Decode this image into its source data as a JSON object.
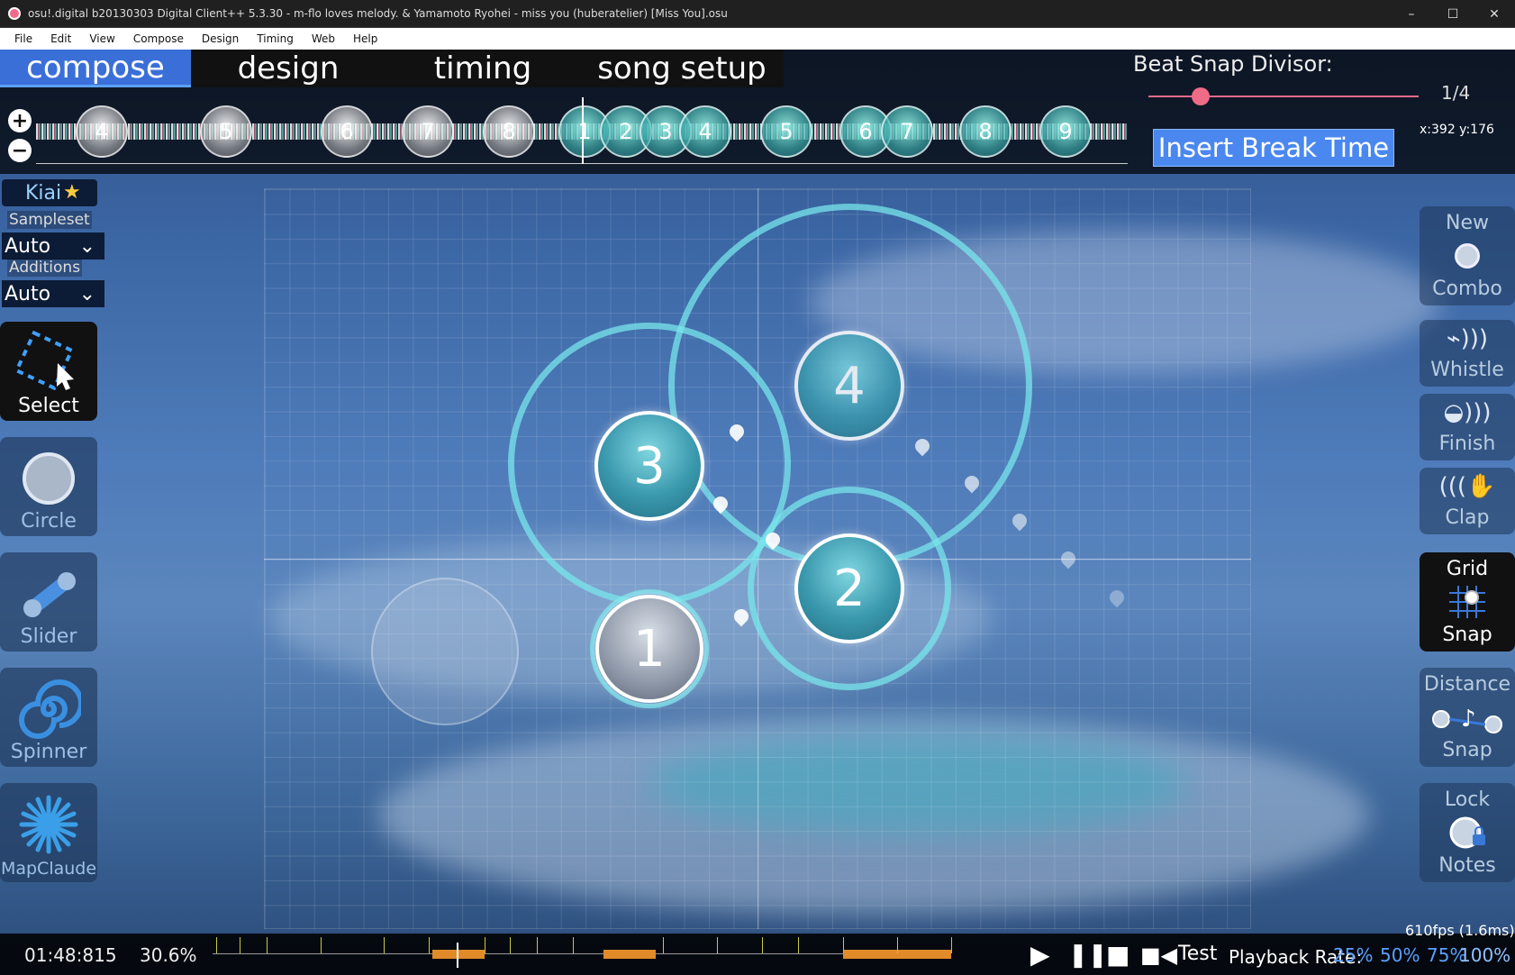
{
  "window": {
    "title": "osu!.digital b20130303 Digital Client++ 5.3.30 - m-flo loves melody. & Yamamoto Ryohei - miss you (huberatelier) [Miss You].osu",
    "minimize": "–",
    "maximize": "☐",
    "close": "✕"
  },
  "menu": [
    "File",
    "Edit",
    "View",
    "Compose",
    "Design",
    "Timing",
    "Web",
    "Help"
  ],
  "tabs": [
    {
      "label": "compose",
      "active": true
    },
    {
      "label": "design",
      "active": false
    },
    {
      "label": "timing",
      "active": false
    },
    {
      "label": "song setup",
      "active": false
    }
  ],
  "beat_snap": {
    "label": "Beat Snap Divisor:",
    "value": "1/4",
    "fraction": 0.18
  },
  "insert_break": "Insert Break Time",
  "cursor_coords": "x:392 y:176",
  "zoom": {
    "in": "+",
    "out": "−"
  },
  "timeline_notes": [
    "4",
    "5",
    "6",
    "7",
    "8",
    "1",
    "2",
    "3",
    "4",
    "5",
    "6",
    "7",
    "8",
    "9"
  ],
  "left_panel": {
    "kiai": "Kiai",
    "sampleset_label": "Sampleset",
    "sampleset_value": "Auto",
    "additions_label": "Additions",
    "additions_value": "Auto",
    "tools": [
      "Select",
      "Circle",
      "Slider",
      "Spinner",
      "MapClaude"
    ]
  },
  "right_panel": [
    {
      "top": "New",
      "bottom": "Combo",
      "icon": "new-combo-icon",
      "active": false
    },
    {
      "top": "",
      "bottom": "Whistle",
      "icon": "whistle-icon",
      "active": false
    },
    {
      "top": "",
      "bottom": "Finish",
      "icon": "finish-icon",
      "active": false
    },
    {
      "top": "",
      "bottom": "Clap",
      "icon": "clap-icon",
      "active": false
    },
    {
      "top": "Grid",
      "bottom": "Snap",
      "icon": "grid-snap-icon",
      "active": true
    },
    {
      "top": "Distance",
      "bottom": "Snap",
      "icon": "distance-snap-icon",
      "active": false
    },
    {
      "top": "Lock",
      "bottom": "Notes",
      "icon": "lock-notes-icon",
      "active": false
    }
  ],
  "hit_objects": [
    "1",
    "2",
    "3",
    "4"
  ],
  "bottom": {
    "time": "01:48:815",
    "progress": "30.6%",
    "test": "Test",
    "playback_label": "Playback Rate:",
    "rates": [
      "25%",
      "50%",
      "75%",
      "100%"
    ],
    "fps": "610fps (1.6ms)"
  },
  "colors": {
    "accent": "#3b6fd8",
    "break_button": "#4a88f0",
    "hitcircle": "#3a98ad",
    "approach": "#78e6eb"
  }
}
